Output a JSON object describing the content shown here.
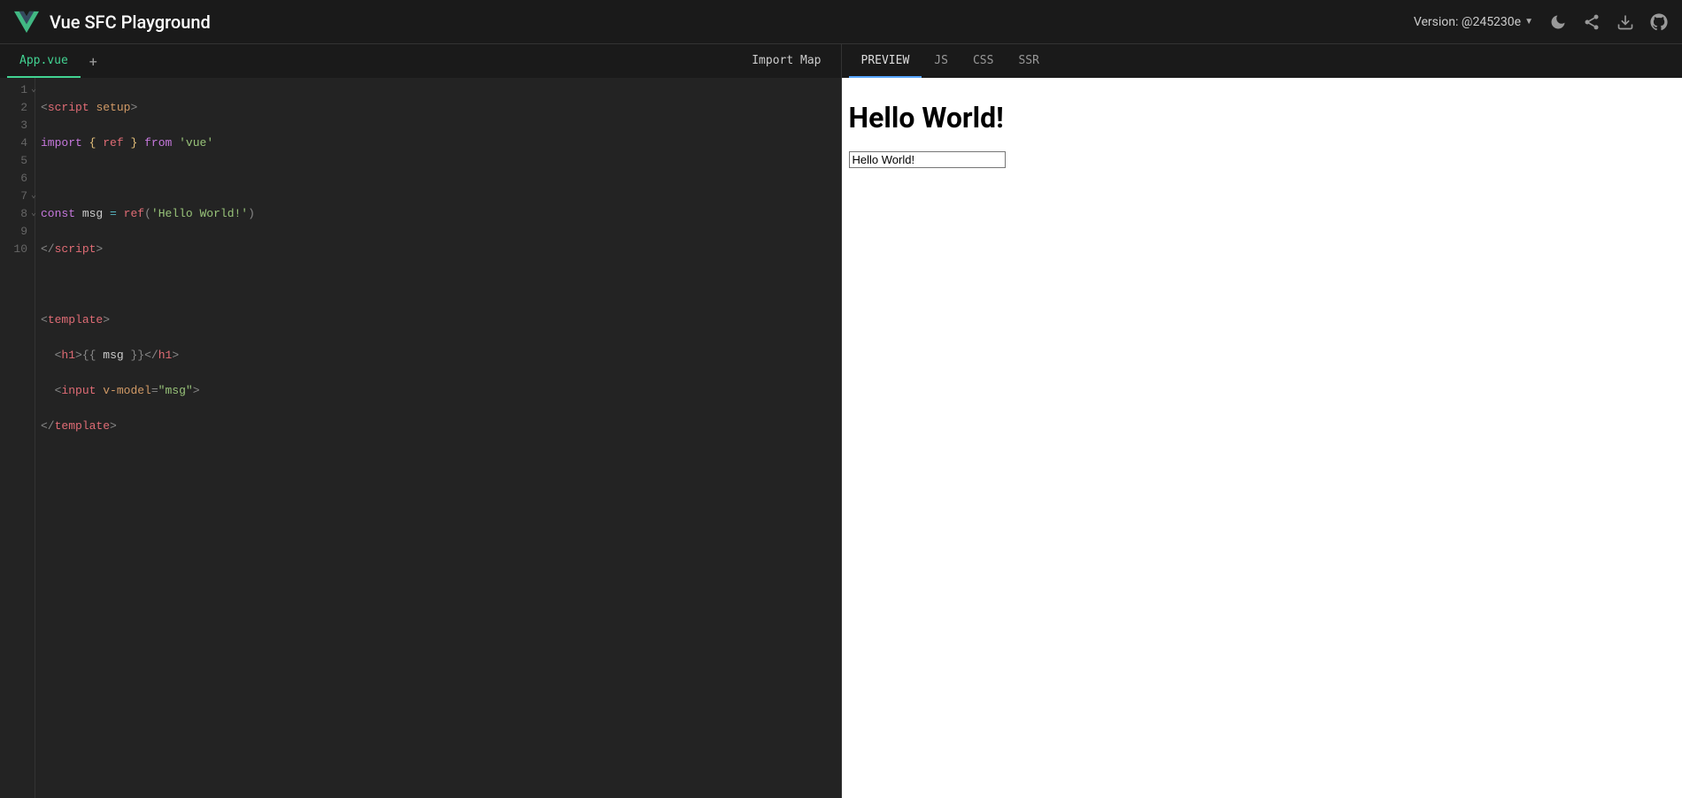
{
  "header": {
    "title": "Vue SFC Playground",
    "version_label": "Version: @245230e",
    "icons": {
      "theme": "moon-icon",
      "share": "share-icon",
      "download": "download-icon",
      "github": "github-icon"
    }
  },
  "left": {
    "tabs": {
      "file": "App.vue",
      "import_map": "Import Map"
    },
    "gutter": [
      "1",
      "2",
      "3",
      "4",
      "5",
      "6",
      "7",
      "8",
      "9",
      "10"
    ],
    "fold_lines": [
      1,
      7,
      8
    ],
    "code": {
      "l1": {
        "open": "<",
        "tag": "script",
        "sp": " ",
        "attr": "setup",
        "close": ">"
      },
      "l2": {
        "kw1": "import",
        "sp1": " ",
        "br1": "{",
        "sp2": " ",
        "id": "ref",
        "sp3": " ",
        "br2": "}",
        "sp4": " ",
        "kw2": "from",
        "sp5": " ",
        "str": "'vue'"
      },
      "l3": "",
      "l4": {
        "kw": "const",
        "sp1": " ",
        "id": "msg",
        "sp2": " ",
        "eq": "=",
        "sp3": " ",
        "fn": "ref",
        "p1": "(",
        "str": "'Hello World!'",
        "p2": ")"
      },
      "l5": {
        "open": "</",
        "tag": "script",
        "close": ">"
      },
      "l6": "",
      "l7": {
        "open": "<",
        "tag": "template",
        "close": ">"
      },
      "l8": {
        "indent": "  ",
        "open": "<",
        "tag": "h1",
        "close": ">",
        "mo": "{{",
        "sp1": " ",
        "id": "msg",
        "sp2": " ",
        "mc": "}}",
        "open2": "</",
        "tag2": "h1",
        "close2": ">"
      },
      "l9": {
        "indent": "  ",
        "open": "<",
        "tag": "input",
        "sp": " ",
        "attr": "v-model",
        "eq": "=",
        "str": "\"msg\"",
        "close": ">"
      },
      "l10": {
        "open": "</",
        "tag": "template",
        "close": ">"
      }
    }
  },
  "right": {
    "tabs": {
      "preview": "PREVIEW",
      "js": "JS",
      "css": "CSS",
      "ssr": "SSR"
    },
    "preview": {
      "heading": "Hello World!",
      "input_value": "Hello World!"
    }
  }
}
